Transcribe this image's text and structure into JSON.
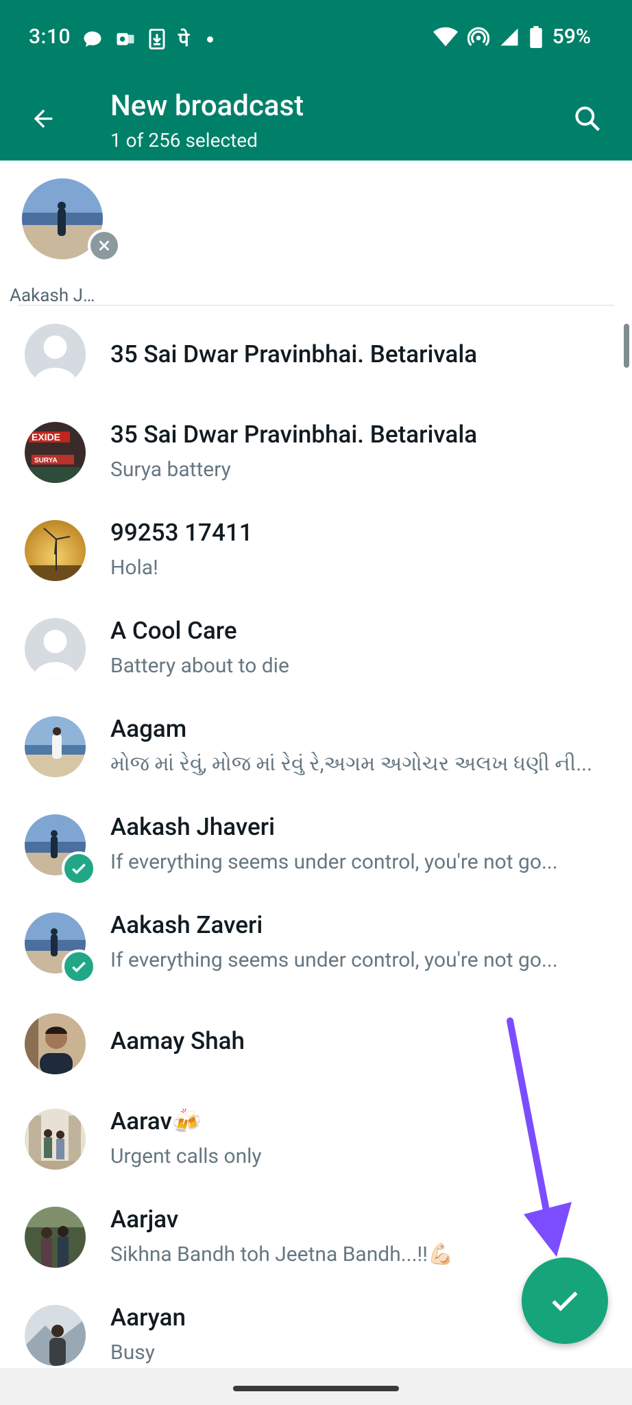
{
  "status_bar": {
    "time": "3:10",
    "left_icons": [
      "chat-bubble-icon",
      "outlook-icon",
      "download-icon",
      "phonepe-icon",
      "dot-icon"
    ],
    "right_icons": [
      "wifi-icon",
      "hotspot-icon",
      "signal-icon",
      "battery-icon"
    ],
    "battery": "59%"
  },
  "header": {
    "title": "New broadcast",
    "subtitle": "1 of 256 selected",
    "background": "#018069"
  },
  "selected": [
    {
      "name": "Aakash J…",
      "avatar": "beach-photo"
    }
  ],
  "contacts": [
    {
      "name": "35 Sai Dwar Pravinbhai. Betarivala",
      "about": "",
      "avatar": "default-avatar",
      "selected": false
    },
    {
      "name": "35 Sai Dwar Pravinbhai. Betarivala",
      "about": "Surya battery",
      "avatar": "exide-photo",
      "selected": false
    },
    {
      "name": "99253 17411",
      "about": "Hola!",
      "avatar": "windmill-photo",
      "selected": false
    },
    {
      "name": "A Cool Care",
      "about": "Battery about to die",
      "avatar": "default-avatar",
      "selected": false
    },
    {
      "name": "Aagam",
      "about": "મોજ માં રેવું, મોજ માં રેવું રે,અગમ અગોચર અલખ ધણી ની...",
      "avatar": "beach-person-photo",
      "selected": false
    },
    {
      "name": "Aakash Jhaveri",
      "about": "If everything seems under control, you're not go...",
      "avatar": "beach-photo",
      "selected": true
    },
    {
      "name": "Aakash Zaveri",
      "about": "If everything seems under control, you're not go...",
      "avatar": "beach-photo",
      "selected": true
    },
    {
      "name": "Aamay Shah",
      "about": "",
      "avatar": "man-photo",
      "selected": false
    },
    {
      "name": "Aarav🍻",
      "about": "Urgent calls only",
      "avatar": "group-photo",
      "selected": false
    },
    {
      "name": "Aarjav",
      "about": "Sikhna Bandh toh Jeetna Bandh...!!💪🏻",
      "avatar": "couple-photo",
      "selected": false
    },
    {
      "name": "Aaryan",
      "about": "Busy",
      "avatar": "snow-photo",
      "selected": false
    }
  ],
  "colors": {
    "accent": "#16a47b",
    "check": "#21a786",
    "arrow": "#7c4dff"
  }
}
